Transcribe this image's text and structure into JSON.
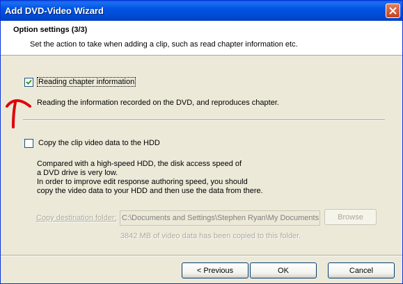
{
  "window": {
    "title": "Add DVD-Video Wizard"
  },
  "header": {
    "title": "Option settings (3/3)",
    "description": "Set the action to take when adding a clip, such as read chapter information etc."
  },
  "options": {
    "read_chapter": {
      "label": "Reading chapter information",
      "checked": true,
      "description": "Reading the information recorded on the DVD, and reproduces chapter."
    },
    "copy_clip": {
      "label": "Copy the clip video data to the HDD",
      "checked": false,
      "description_lines": [
        "Compared with a high-speed HDD, the disk access speed of",
        "a DVD drive is very low.",
        "In order to improve edit response authoring speed, you should",
        "copy the video data to your HDD and then use the data from there."
      ]
    }
  },
  "destination": {
    "label": "Copy destination folder:",
    "value": "C:\\Documents and Settings\\Stephen Ryan\\My Documents",
    "browse_label": "Browse",
    "status": "3842 MB of video data has been copied to this folder."
  },
  "buttons": {
    "previous": "< Previous",
    "ok": "OK",
    "cancel": "Cancel"
  }
}
